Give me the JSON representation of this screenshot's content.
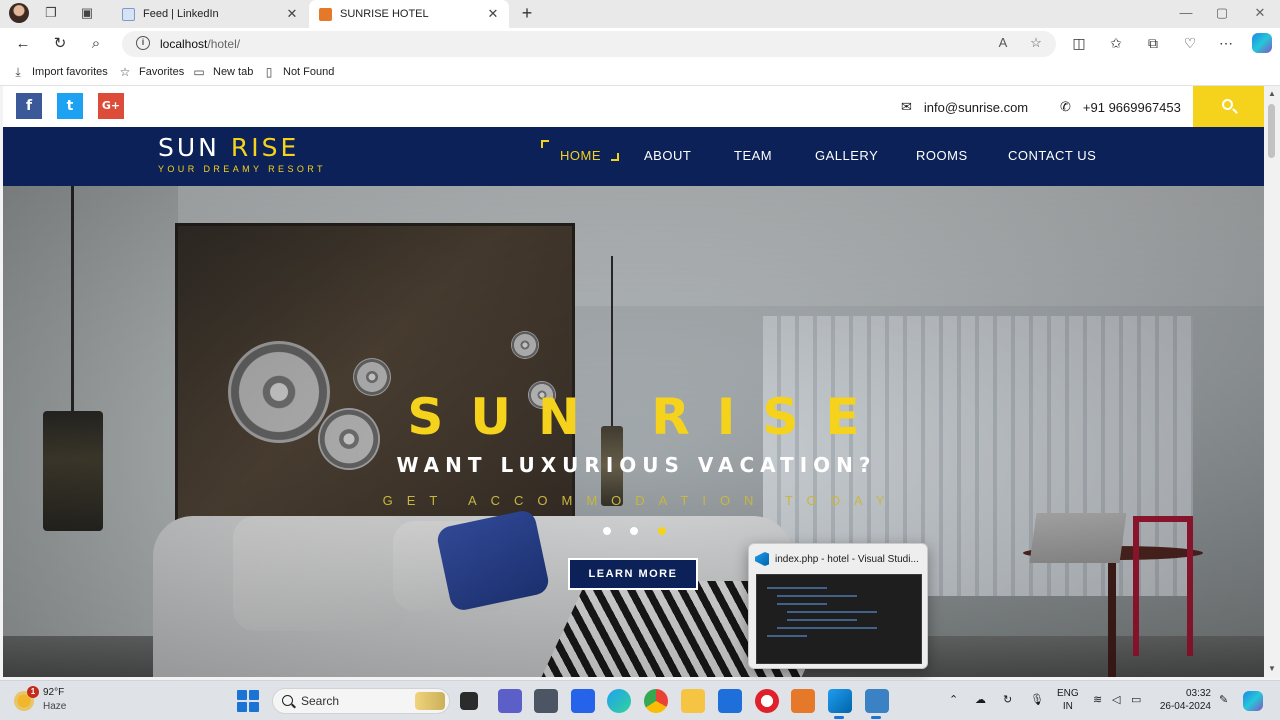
{
  "browser": {
    "tabs": [
      {
        "label": "Feed | LinkedIn",
        "icon": "linkedin-icon",
        "active": false
      },
      {
        "label": "SUNRISE HOTEL",
        "icon": "xampp-icon",
        "active": true
      }
    ],
    "address": {
      "host": "localhost",
      "path": "/hotel/"
    },
    "favorites_bar": [
      {
        "label": "Import favorites",
        "icon": "import-icon"
      },
      {
        "label": "Favorites",
        "icon": "star-icon"
      },
      {
        "label": "New tab",
        "icon": "newtab-icon"
      },
      {
        "label": "Not Found",
        "icon": "page-icon"
      }
    ]
  },
  "site": {
    "topbar": {
      "email": "info@sunrise.com",
      "phone": "+91 9669967453",
      "social": [
        {
          "label": "f",
          "icon": "facebook-icon",
          "color": "#3b5998"
        },
        {
          "label": "t",
          "icon": "twitter-icon",
          "color": "#1da1f2"
        },
        {
          "label": "G+",
          "icon": "google-plus-icon",
          "color": "#dd4b39"
        }
      ],
      "search_color": "#f5d21c"
    },
    "brand": {
      "name_a": "SUN",
      "name_b": "RISE",
      "tagline": "YOUR DREAMY RESORT"
    },
    "nav": [
      {
        "label": "HOME",
        "active": true
      },
      {
        "label": "ABOUT"
      },
      {
        "label": "TEAM"
      },
      {
        "label": "GALLERY"
      },
      {
        "label": "ROOMS"
      },
      {
        "label": "CONTACT US"
      }
    ],
    "hero": {
      "title": "SUN RISE",
      "subtitle": "WANT LUXURIOUS VACATION?",
      "tagline": "GET ACCOMMODATION TODAY",
      "cta": "LEARN MORE",
      "slides": 3,
      "active_slide": 3
    },
    "colors": {
      "navy": "#0c2158",
      "accent": "#f5d21c"
    }
  },
  "taskbar_preview": {
    "title": "index.php - hotel - Visual Studi..."
  },
  "taskbar": {
    "weather": {
      "temp": "92°F",
      "condition": "Haze",
      "alerts": "1"
    },
    "search_placeholder": "Search",
    "language": {
      "line1": "ENG",
      "line2": "IN"
    },
    "time": "03:32",
    "date": "26-04-2024"
  }
}
